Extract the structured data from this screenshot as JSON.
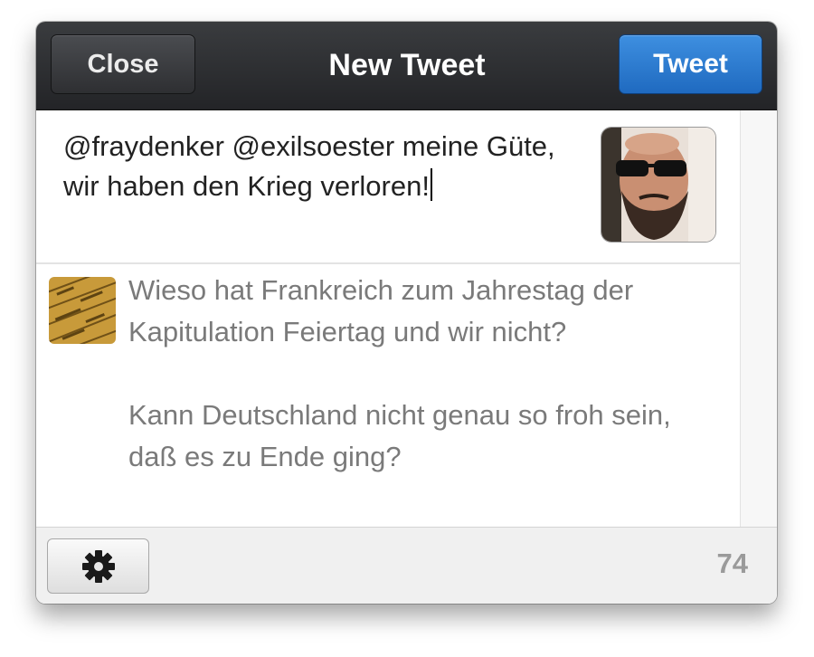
{
  "header": {
    "close_label": "Close",
    "title": "New Tweet",
    "tweet_label": "Tweet"
  },
  "compose": {
    "text": "@fraydenker @exilsoester meine Güte, wir haben den Krieg verloren!",
    "avatar_icon": "user-avatar-photo"
  },
  "reply": {
    "avatar_icon": "reply-author-avatar",
    "paragraphs": [
      "Wieso hat Frankreich zum Jahrestag der Kapitulation Feiertag und wir nicht?",
      "Kann Deutschland nicht genau so froh sein, daß es zu Ende ging?"
    ]
  },
  "footer": {
    "settings_icon": "gear-icon",
    "char_count": "74"
  },
  "colors": {
    "titlebar": "#2c2d30",
    "tweet_button": "#2a7ad4",
    "reply_text": "#7a7a7a",
    "count_text": "#9a9a9a"
  }
}
